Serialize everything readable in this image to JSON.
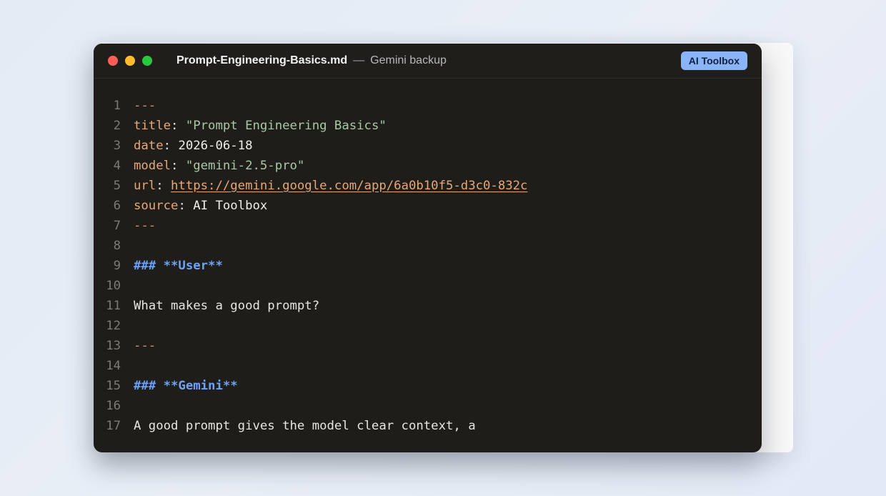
{
  "window": {
    "filename": "Prompt-Engineering-Basics.md",
    "separator": "—",
    "subtitle": "Gemini backup",
    "badge": "AI Toolbox"
  },
  "lines": {
    "l1": "---",
    "l2_key": "title",
    "l2_val": "\"Prompt Engineering Basics\"",
    "l3_key": "date",
    "l3_val": "2026-06-18",
    "l4_key": "model",
    "l4_val": "\"gemini-2.5-pro\"",
    "l5_key": "url",
    "l5_val": "https://gemini.google.com/app/6a0b10f5-d3c0-832c",
    "l6_key": "source",
    "l6_val": "AI Toolbox",
    "l7": "---",
    "l9": "### **User**",
    "l11": "What makes a good prompt?",
    "l13": "---",
    "l15": "### **Gemini**",
    "l17": "A good prompt gives the model clear context, a"
  },
  "line_numbers": [
    "1",
    "2",
    "3",
    "4",
    "5",
    "6",
    "7",
    "8",
    "9",
    "10",
    "11",
    "12",
    "13",
    "14",
    "15",
    "16",
    "17"
  ],
  "colors": {
    "key": "#e5a878",
    "string": "#a8c8a8",
    "heading": "#6ea2f7",
    "badge_bg": "#8ab4f8"
  }
}
